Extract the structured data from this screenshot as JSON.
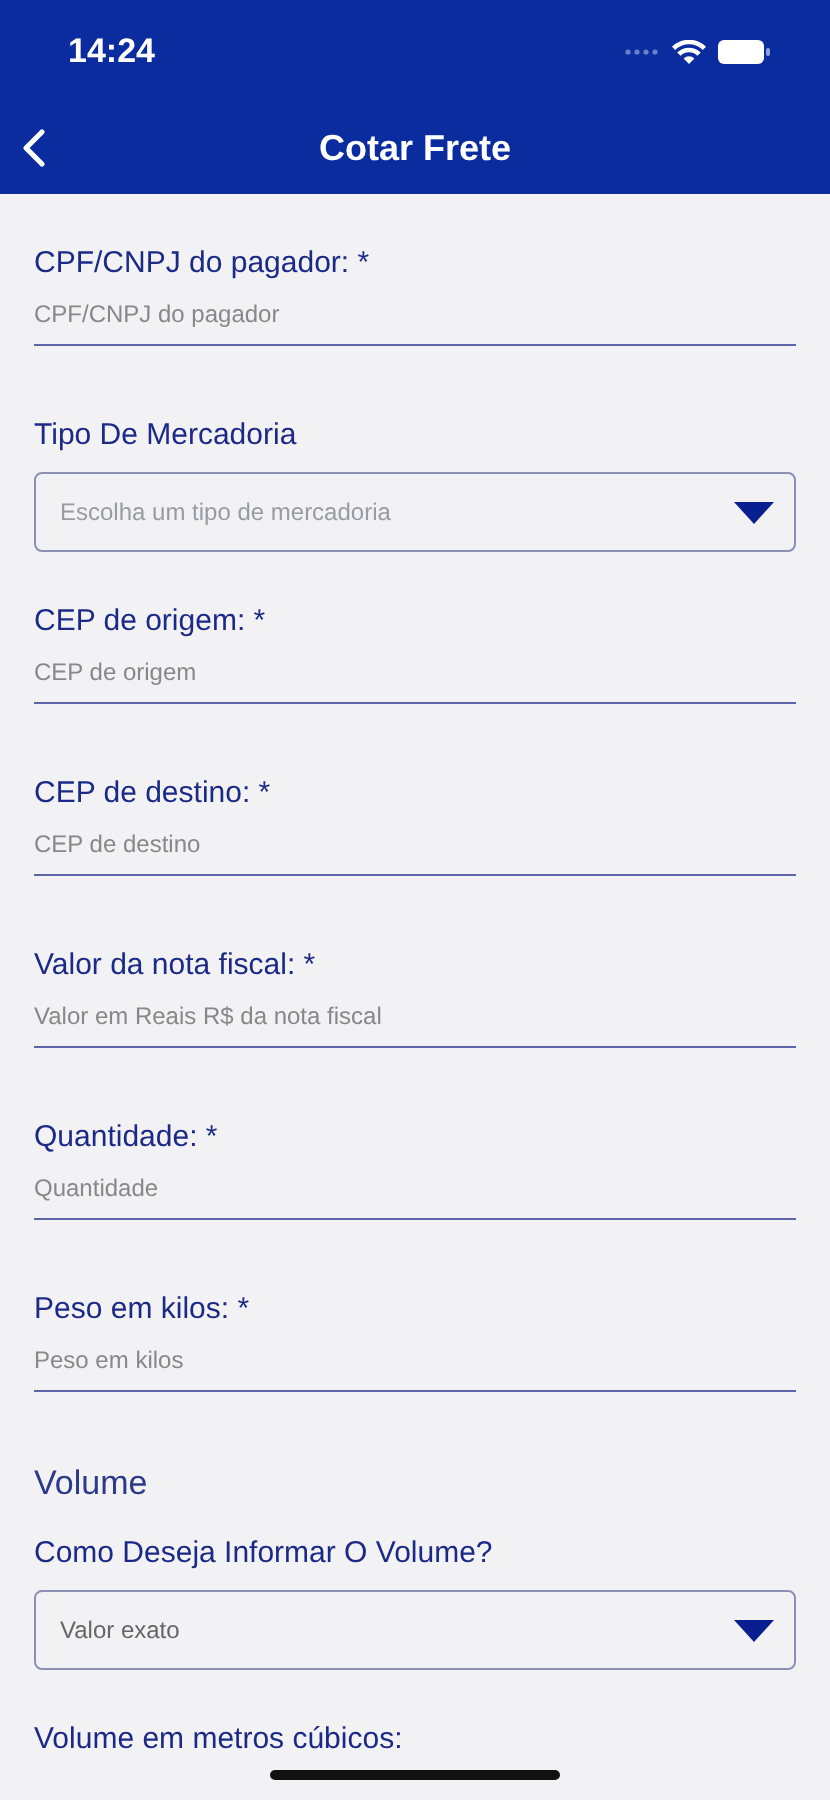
{
  "status_bar": {
    "time": "14:24"
  },
  "nav_bar": {
    "title": "Cotar Frete"
  },
  "form": [
    {
      "kind": "text",
      "label": "CPF/CNPJ do pagador: *",
      "placeholder": "CPF/CNPJ do pagador"
    },
    {
      "kind": "select",
      "label": "Tipo De Mercadoria",
      "placeholder": "Escolha um tipo de mercadoria"
    },
    {
      "kind": "text",
      "label": "CEP de origem: *",
      "placeholder": "CEP de origem"
    },
    {
      "kind": "text",
      "label": "CEP de destino: *",
      "placeholder": "CEP de destino"
    },
    {
      "kind": "text",
      "label": "Valor da nota fiscal: *",
      "placeholder": "Valor em Reais R$ da nota fiscal"
    },
    {
      "kind": "text",
      "label": "Quantidade: *",
      "placeholder": "Quantidade"
    },
    {
      "kind": "text",
      "label": "Peso em kilos: *",
      "placeholder": "Peso em kilos"
    },
    {
      "kind": "heading",
      "label": "Volume"
    },
    {
      "kind": "select",
      "label": "Como Deseja Informar O Volume?",
      "value": "Valor exato"
    },
    {
      "kind": "label",
      "label": "Volume em metros cúbicos:"
    }
  ]
}
